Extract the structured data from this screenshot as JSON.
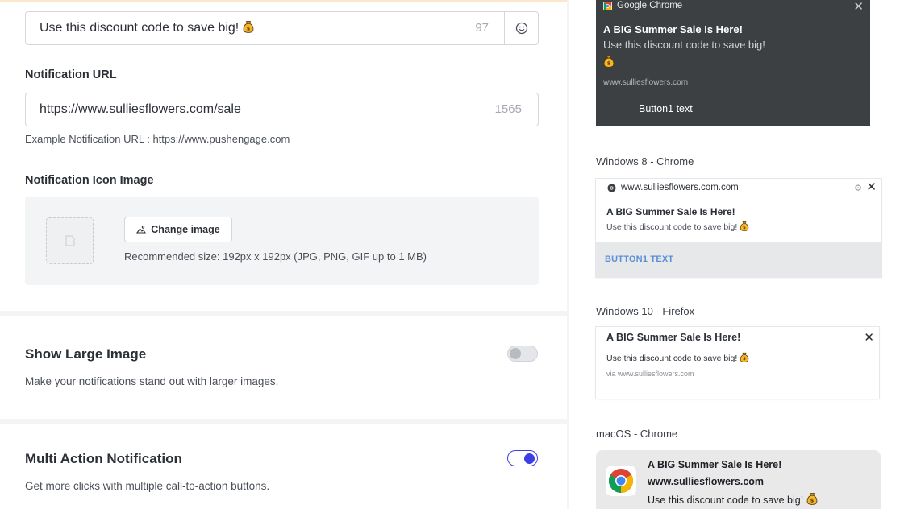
{
  "message_field": {
    "value": "Use this discount code to save big!",
    "emoji": "money-bag-emoji",
    "counter": "97"
  },
  "url_field": {
    "label": "Notification URL",
    "value": "https://www.sulliesflowers.com/sale",
    "counter": "1565",
    "example": "Example Notification URL : https://www.pushengage.com"
  },
  "icon_image": {
    "label": "Notification Icon Image",
    "change_label": "Change image",
    "recommended": "Recommended size: 192px x 192px (JPG, PNG, GIF up to 1 MB)"
  },
  "large_image": {
    "title": "Show Large Image",
    "desc": "Make your notifications stand out with larger images.",
    "enabled": false
  },
  "multi_action": {
    "title": "Multi Action Notification",
    "desc": "Get more clicks with multiple call-to-action buttons.",
    "enabled": true
  },
  "previews": {
    "google_chrome": {
      "app": "Google Chrome",
      "title": "A BIG Summer Sale Is Here!",
      "message": "Use this discount code to save big!",
      "site": "www.sulliesflowers.com",
      "button": "Button1 text"
    },
    "windows8": {
      "caption": "Windows 8 - Chrome",
      "site": "www.sulliesflowers.com.com",
      "title": "A BIG Summer Sale Is Here!",
      "message": "Use this discount code to save big!",
      "button": "BUTTON1 TEXT"
    },
    "windows10": {
      "caption": "Windows 10 - Firefox",
      "title": "A BIG Summer Sale Is Here!",
      "message": "Use this discount code to save big!",
      "via": "via www.sulliesflowers.com"
    },
    "macos": {
      "caption": "macOS - Chrome",
      "title": "A BIG Summer Sale Is Here!",
      "site": "www.sulliesflowers.com",
      "message": "Use this discount code to save big!"
    }
  },
  "colors": {
    "accent": "#3b3fe4",
    "preview_dark": "#3c4043",
    "button_link": "#5b8fd6"
  }
}
